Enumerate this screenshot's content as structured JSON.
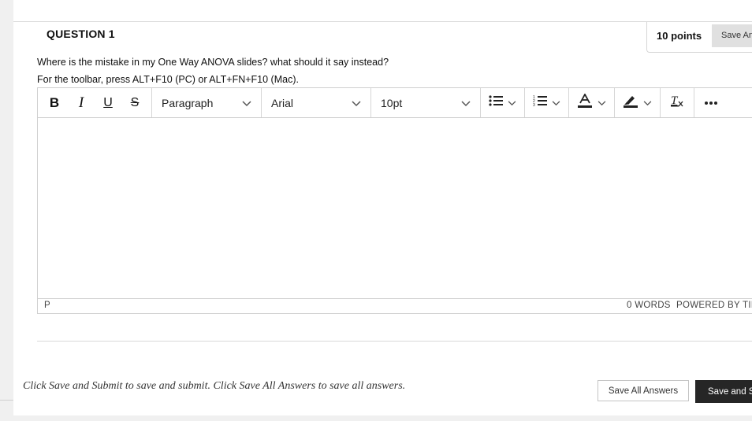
{
  "question": {
    "title": "QUESTION 1",
    "points": "10 points",
    "save_answer_label": "Save Answer",
    "text": "Where is the mistake in my One Way ANOVA slides? what should it say instead?",
    "toolbar_hint": "For the toolbar, press ALT+F10 (PC) or ALT+FN+F10 (Mac)."
  },
  "editor": {
    "toolbar": {
      "bold": "B",
      "italic": "I",
      "underline": "U",
      "strikethrough": "S",
      "block_format": "Paragraph",
      "font_family": "Arial",
      "font_size": "10pt"
    },
    "icons": {
      "bullet_list": "bullet-list-icon",
      "numbered_list": "numbered-list-icon",
      "text_color": "text-color-icon",
      "highlight": "highlight-icon",
      "clear_format": "clear-formatting-icon",
      "more": "more-icon",
      "chevron": "chevron-down-icon"
    },
    "body_text": "",
    "status": {
      "path": "P",
      "word_count": "0 WORDS",
      "powered_by": "POWERED BY TINY"
    }
  },
  "footer": {
    "note": "Click Save and Submit to save and submit. Click Save All Answers to save all answers.",
    "save_all_label": "Save All Answers",
    "save_submit_label": "Save and Submit"
  },
  "colors": {
    "primary_button": "#262626",
    "secondary_button": "#e0e0e0",
    "border": "#cfcfcf",
    "page_bg": "#ffffff",
    "outer_bg": "#f0f0f0"
  }
}
